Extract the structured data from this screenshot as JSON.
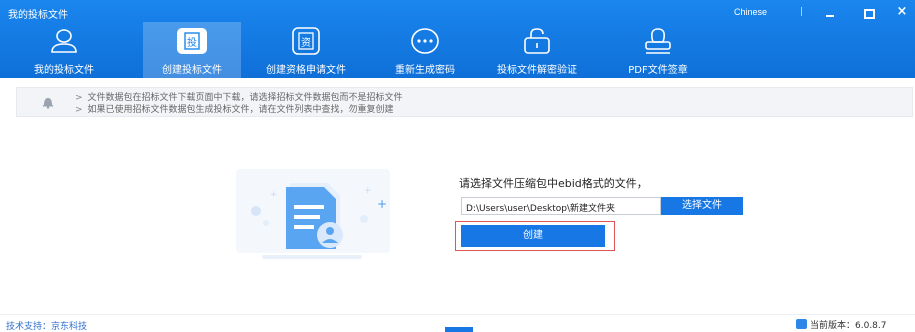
{
  "window": {
    "title": "我的投标文件",
    "language": "Chinese",
    "separator": "|",
    "close_glyph": "×"
  },
  "nav": {
    "items": [
      {
        "label": "我的投标文件",
        "icon": "user-icon",
        "active": false
      },
      {
        "label": "创建投标文件",
        "icon": "bid-document-icon",
        "active": true
      },
      {
        "label": "创建资格申请文件",
        "icon": "qualification-document-icon",
        "active": false
      },
      {
        "label": "重新生成密码",
        "icon": "regenerate-password-icon",
        "active": false
      },
      {
        "label": "投标文件解密验证",
        "icon": "unlock-icon",
        "active": false
      },
      {
        "label": "PDF文件签章",
        "icon": "signature-icon",
        "active": false
      }
    ],
    "active_color": "#ffffff"
  },
  "notice": {
    "icon": "bell-icon",
    "line1": "文件数据包在招标文件下载页面中下载，请选择招标文件数据包而不是招标文件",
    "line2": "如果已使用招标文件数据包生成投标文件，请在文件列表中查找，勿重复创建",
    "arrow": ">"
  },
  "main": {
    "illustration": "document-upload-illustration",
    "prompt": "请选择文件压缩包中ebid格式的文件，",
    "path_value": "D:\\Users\\user\\Desktop\\新建文件夹",
    "choose_button": "选择文件",
    "create_button": "创建"
  },
  "footer": {
    "support": "技术支持：京东科技",
    "version": "当前版本：6.0.8.7"
  },
  "colors": {
    "header": "#1a86ee",
    "primary_button": "#1677e5",
    "highlight_border": "#e05555",
    "footer_link": "#2f6fce"
  }
}
